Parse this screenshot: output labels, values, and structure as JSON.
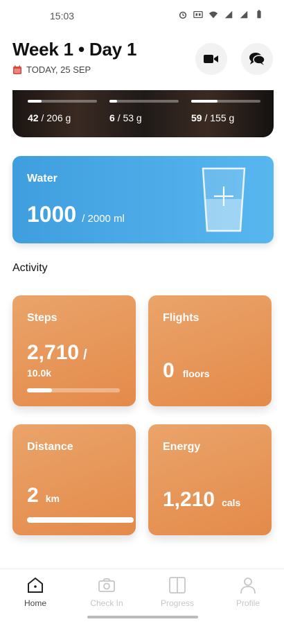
{
  "status_bar": {
    "time": "15:03",
    "icons": [
      "alarm-icon",
      "nfc-icon",
      "wifi-icon",
      "signal-icon",
      "signal-icon",
      "battery-icon"
    ]
  },
  "header": {
    "title": "Week 1 • Day 1",
    "date": "TODAY, 25 SEP",
    "date_icon": "calendar-icon",
    "video_button_icon": "video-camera-icon",
    "chat_button_icon": "chat-icon"
  },
  "macros": [
    {
      "current": "42",
      "target": "/ 206 g",
      "progress": 0.2
    },
    {
      "current": "6",
      "target": "/ 53 g",
      "progress": 0.11
    },
    {
      "current": "59",
      "target": "/ 155 g",
      "progress": 0.38
    }
  ],
  "water": {
    "title": "Water",
    "value": "1000",
    "target": "/ 2000 ml",
    "progress": 0.5,
    "icon": "water-glass-add-icon"
  },
  "activity": {
    "section_title": "Activity",
    "steps": {
      "title": "Steps",
      "value": "2,710",
      "slash": "/",
      "goal": "10.0k",
      "progress": 0.27
    },
    "flights": {
      "title": "Flights",
      "value": "0",
      "unit": "floors"
    },
    "distance": {
      "title": "Distance",
      "value": "2",
      "unit": "km",
      "progress": 1.0
    },
    "energy": {
      "title": "Energy",
      "value": "1,210",
      "unit": "cals"
    }
  },
  "bottom_nav": {
    "items": [
      {
        "label": "Home",
        "icon": "home-icon",
        "active": true
      },
      {
        "label": "Check In",
        "icon": "camera-icon",
        "active": false
      },
      {
        "label": "Progress",
        "icon": "progress-panel-icon",
        "active": false
      },
      {
        "label": "Profile",
        "icon": "profile-icon",
        "active": false
      }
    ]
  },
  "colors": {
    "water_gradient_start": "#3f9ede",
    "water_gradient_end": "#58b6ef",
    "activity_gradient_start": "#eaa46a",
    "activity_gradient_end": "#e48a4a",
    "accent_red": "#e0473c"
  }
}
